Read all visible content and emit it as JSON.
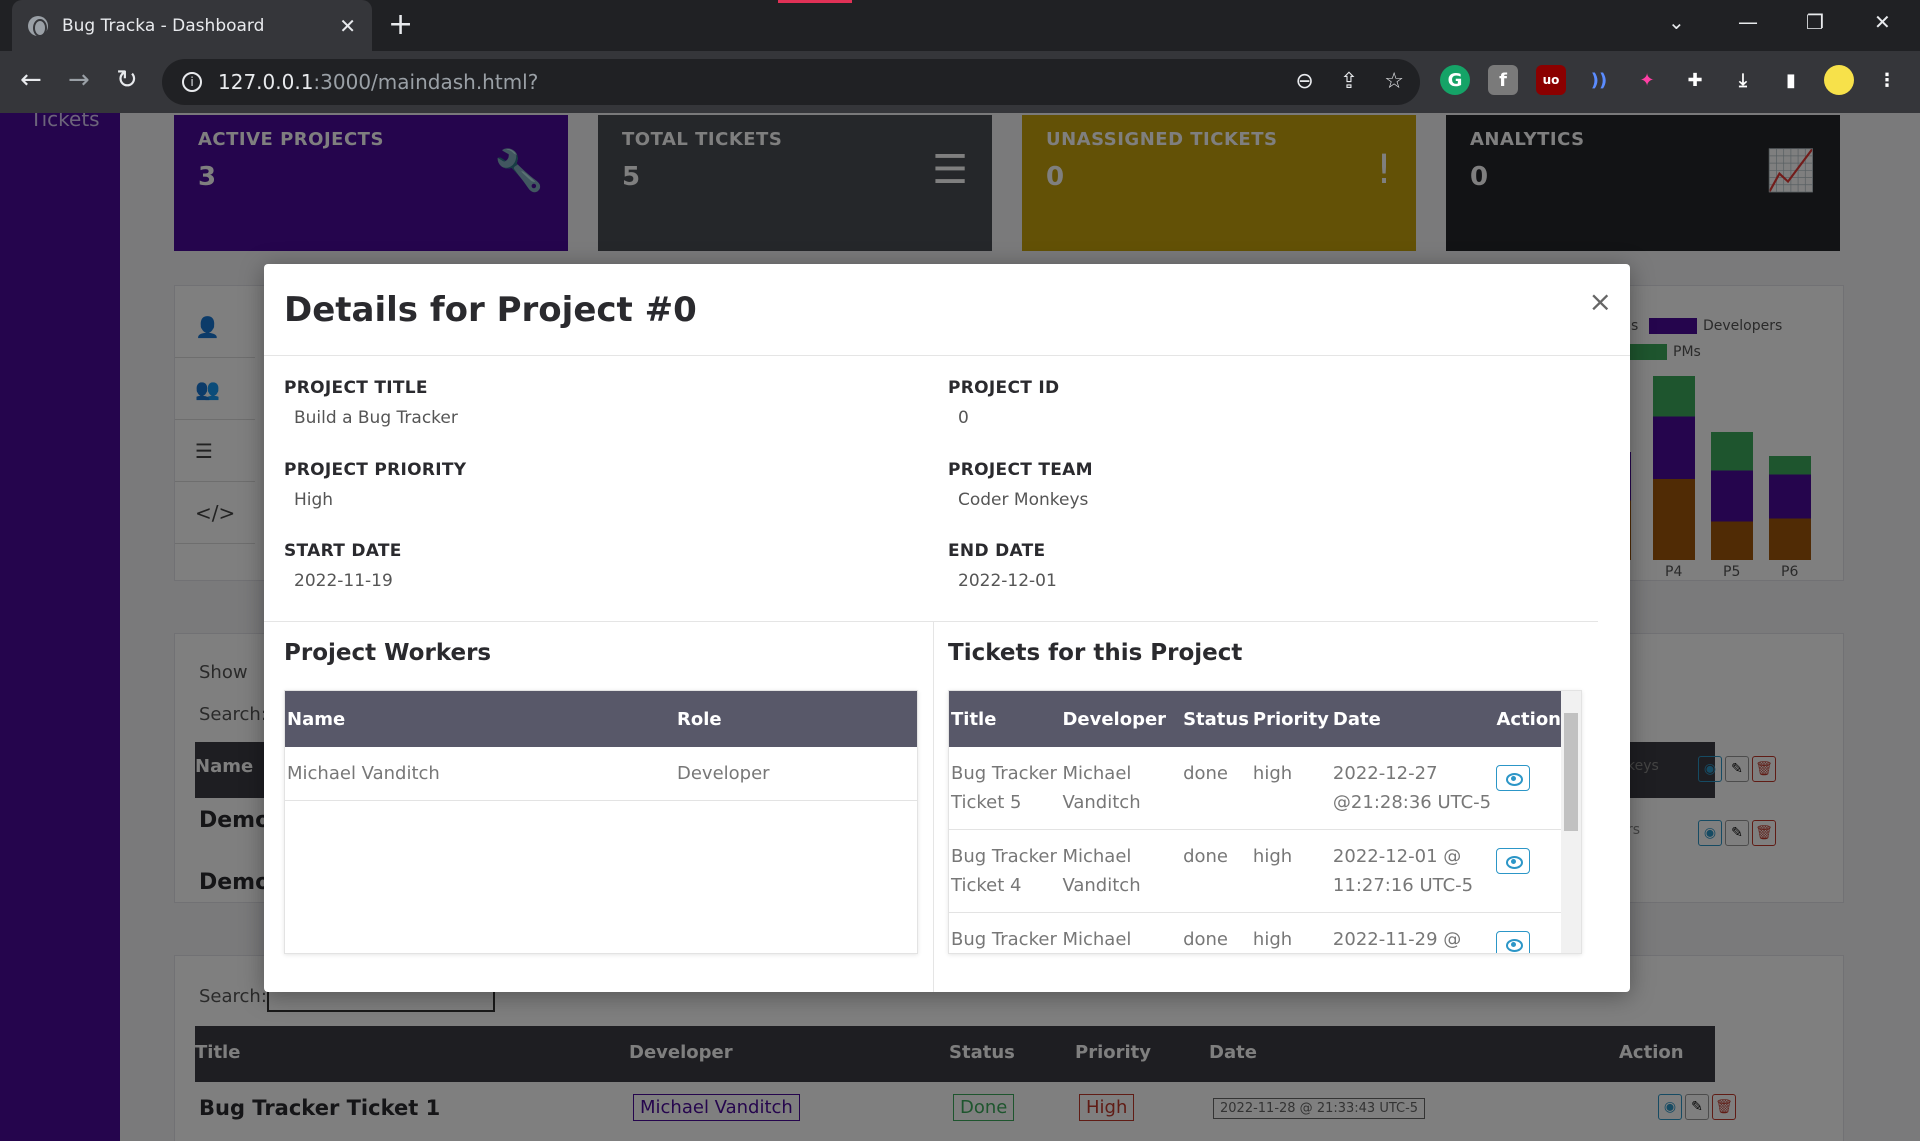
{
  "browser": {
    "tab_title": "Bug Tracka - Dashboard",
    "url_host": "127.0.0.1",
    "url_path": ":3000/maindash.html?"
  },
  "background": {
    "sidebar_label": "Tickets",
    "cards": [
      {
        "label": "ACTIVE PROJECTS",
        "value": "3",
        "icon": "wrench-icon",
        "color": "#4b0a9a"
      },
      {
        "label": "TOTAL TICKETS",
        "value": "5",
        "icon": "layers-icon",
        "color": "#4b4f54"
      },
      {
        "label": "UNASSIGNED TICKETS",
        "value": "0",
        "icon": "exclamation-icon",
        "color": "#c6a20d"
      },
      {
        "label": "ANALYTICS",
        "value": "0",
        "icon": "chart-line-icon",
        "color": "#25262a"
      }
    ],
    "legend": {
      "developers": "Developers",
      "pms": "PMs",
      "partial": "s"
    },
    "chart_ticks": [
      "P4",
      "P5",
      "P6"
    ],
    "show_label": "Show",
    "search_label": "Search:",
    "name_header": "Name",
    "demo_rows": [
      "Demo",
      "Demo"
    ],
    "partial_cells": [
      "keys",
      "rs"
    ],
    "tickets_table": {
      "headers": [
        "Title",
        "Developer",
        "Status",
        "Priority",
        "Date",
        "Action"
      ],
      "search_label": "Search:",
      "row": {
        "title": "Bug Tracker Ticket 1",
        "developer": "Michael Vanditch",
        "status": "Done",
        "priority": "High",
        "date": "2022-11-28 @ 21:33:43 UTC-5"
      }
    }
  },
  "modal": {
    "title": "Details for Project #0",
    "fields": {
      "project_title": {
        "label": "PROJECT TITLE",
        "value": "Build a Bug Tracker"
      },
      "project_id": {
        "label": "PROJECT ID",
        "value": "0"
      },
      "project_priority": {
        "label": "PROJECT PRIORITY",
        "value": "High"
      },
      "project_team": {
        "label": "PROJECT TEAM",
        "value": "Coder Monkeys"
      },
      "start_date": {
        "label": "START DATE",
        "value": "2022-11-19"
      },
      "end_date": {
        "label": "END DATE",
        "value": "2022-12-01"
      }
    },
    "workers": {
      "title": "Project Workers",
      "headers": [
        "Name",
        "Role"
      ],
      "rows": [
        {
          "name": "Michael Vanditch",
          "role": "Developer"
        }
      ]
    },
    "tickets": {
      "title": "Tickets for this Project",
      "headers": [
        "Title",
        "Developer",
        "Status",
        "Priority",
        "Date",
        "Action"
      ],
      "rows": [
        {
          "title": "Bug Tracker Ticket 5",
          "developer": "Michael Vanditch",
          "status": "done",
          "priority": "high",
          "date": "2022-12-27 @21:28:36 UTC-5"
        },
        {
          "title": "Bug Tracker Ticket 4",
          "developer": "Michael Vanditch",
          "status": "done",
          "priority": "high",
          "date": "2022-12-01 @ 11:27:16 UTC-5"
        },
        {
          "title": "Bug Tracker",
          "developer": "Michael",
          "status": "done",
          "priority": "high",
          "date": "2022-11-29 @"
        }
      ]
    }
  }
}
